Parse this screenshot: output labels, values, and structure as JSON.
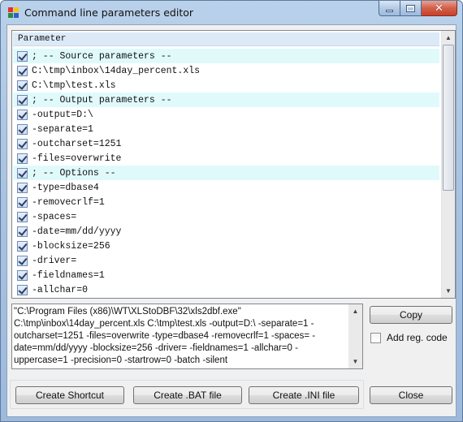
{
  "window": {
    "title": "Command line parameters editor"
  },
  "list": {
    "header": "Parameter",
    "rows": [
      {
        "text": "; -- Source parameters --",
        "section": true
      },
      {
        "text": "C:\\tmp\\inbox\\14day_percent.xls",
        "section": false
      },
      {
        "text": "C:\\tmp\\test.xls",
        "section": false
      },
      {
        "text": "; -- Output parameters --",
        "section": true
      },
      {
        "text": "-output=D:\\",
        "section": false
      },
      {
        "text": "-separate=1",
        "section": false
      },
      {
        "text": "-outcharset=1251",
        "section": false
      },
      {
        "text": "-files=overwrite",
        "section": false
      },
      {
        "text": "; -- Options --",
        "section": true
      },
      {
        "text": "-type=dbase4",
        "section": false
      },
      {
        "text": "-removecrlf=1",
        "section": false
      },
      {
        "text": "-spaces=",
        "section": false
      },
      {
        "text": "-date=mm/dd/yyyy",
        "section": false
      },
      {
        "text": "-blocksize=256",
        "section": false
      },
      {
        "text": "-driver=",
        "section": false
      },
      {
        "text": "-fieldnames=1",
        "section": false
      },
      {
        "text": "-allchar=0",
        "section": false
      }
    ]
  },
  "command_text": "\"C:\\Program Files (x86)\\WT\\XLStoDBF\\32\\xls2dbf.exe\" C:\\tmp\\inbox\\14day_percent.xls C:\\tmp\\test.xls -output=D:\\ -separate=1 -outcharset=1251 -files=overwrite -type=dbase4 -removecrlf=1 -spaces= -date=mm/dd/yyyy -blocksize=256 -driver= -fieldnames=1 -allchar=0 -uppercase=1 -precision=0 -startrow=0 -batch -silent",
  "buttons": {
    "copy": "Copy",
    "add_reg_code": "Add reg. code",
    "create_shortcut": "Create Shortcut",
    "create_bat": "Create .BAT file",
    "create_ini": "Create .INI file",
    "close": "Close"
  },
  "icons": {
    "app": "app-icon",
    "minimize": "minimize-icon",
    "maximize": "maximize-icon",
    "close": "close-icon",
    "scroll_up": "scroll-up-icon",
    "scroll_down": "scroll-down-icon"
  },
  "colors": {
    "section_row": "#e0fafc",
    "header_bg": "#dceaf8",
    "close_button": "#c7402a"
  }
}
